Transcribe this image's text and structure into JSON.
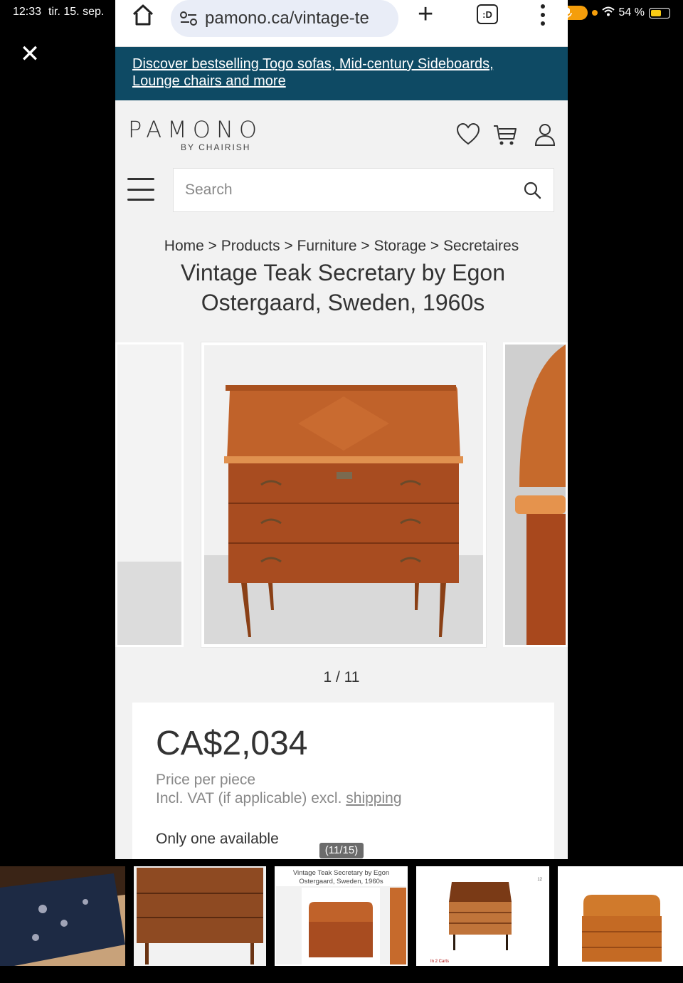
{
  "status_bar": {
    "time": "12:33",
    "date": "tir. 15. sep.",
    "battery": "54 %"
  },
  "browser": {
    "url": "pamono.ca/vintage-te",
    "tabs_label": ":D"
  },
  "promo_banner": {
    "line1": "Discover bestselling Togo sofas, Mid-century Sideboards,",
    "line2": "Lounge chairs and more"
  },
  "brand": {
    "logo": "PAMONO",
    "sub": "BY CHAIRISH"
  },
  "search": {
    "placeholder": "Search"
  },
  "breadcrumb": {
    "text": "Home > Products > Furniture > Storage > Secretaires"
  },
  "product": {
    "title": "Vintage Teak Secretary by Egon Ostergaard, Sweden, 1960s",
    "image_counter": "1 / 11",
    "price": "CA$2,034",
    "price_note": "Price per piece",
    "vat_note": "Incl. VAT (if applicable) excl.",
    "shipping_link": "shipping",
    "availability": "Only one available"
  },
  "viewer": {
    "page_counter": "(11/15)",
    "thumb3_title": "Vintage Teak Secretary by Egon Ostergaard, Sweden, 1960s",
    "thumb4_carts": "In 2 Carts",
    "thumb4_likes": "12"
  },
  "colors": {
    "promo_bg": "#0e4a64",
    "teak": "#b55a26",
    "page_bg": "#f2f2f2"
  },
  "icons": [
    "home-icon",
    "site-settings-icon",
    "plus-icon",
    "tabs-icon",
    "menu-icon",
    "mic-icon",
    "wifi-icon",
    "battery-icon",
    "close-icon",
    "heart-icon",
    "cart-icon",
    "user-icon",
    "hamburger-icon",
    "search-icon"
  ]
}
